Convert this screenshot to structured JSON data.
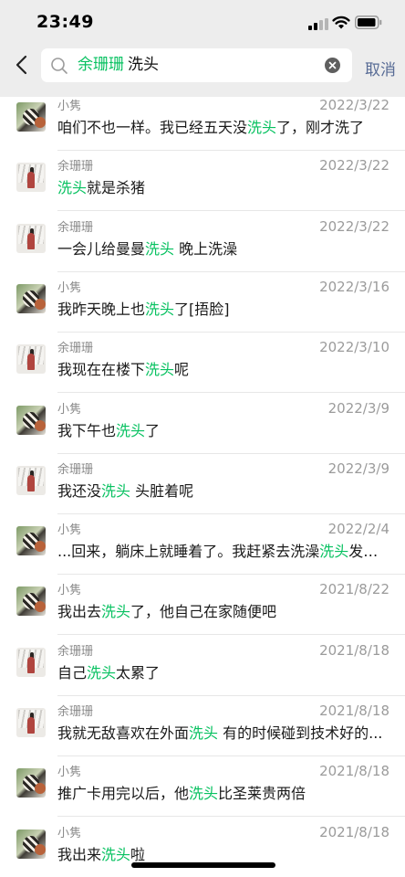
{
  "status_bar": {
    "time": "23:49"
  },
  "search": {
    "contact": "余珊珊",
    "keyword": "洗头",
    "cancel_label": "取消"
  },
  "results": [
    {
      "sender": "小隽",
      "avatar": "a",
      "date": "2022/3/22",
      "before": "咱们不也一样。我已经五天没",
      "match": "洗头",
      "after": "了，刚才洗了"
    },
    {
      "sender": "余珊珊",
      "avatar": "b",
      "date": "2022/3/22",
      "before": "",
      "match": "洗头",
      "after": "就是杀猪"
    },
    {
      "sender": "余珊珊",
      "avatar": "b",
      "date": "2022/3/22",
      "before": "一会儿给曼曼",
      "match": "洗头",
      "after": " 晚上洗澡"
    },
    {
      "sender": "小隽",
      "avatar": "a",
      "date": "2022/3/16",
      "before": "我昨天晚上也",
      "match": "洗头",
      "after": "了[捂脸]"
    },
    {
      "sender": "余珊珊",
      "avatar": "b",
      "date": "2022/3/10",
      "before": "我现在在楼下",
      "match": "洗头",
      "after": "呢"
    },
    {
      "sender": "小隽",
      "avatar": "a",
      "date": "2022/3/9",
      "before": "我下午也",
      "match": "洗头",
      "after": "了"
    },
    {
      "sender": "余珊珊",
      "avatar": "b",
      "date": "2022/3/9",
      "before": "我还没",
      "match": "洗头",
      "after": " 头脏着呢"
    },
    {
      "sender": "小隽",
      "avatar": "a",
      "date": "2022/2/4",
      "before": "...回来，躺床上就睡着了。我赶紧去洗澡",
      "match": "洗头",
      "after": "发，..."
    },
    {
      "sender": "小隽",
      "avatar": "a",
      "date": "2021/8/22",
      "before": "我出去",
      "match": "洗头",
      "after": "了，他自己在家随便吧"
    },
    {
      "sender": "余珊珊",
      "avatar": "b",
      "date": "2021/8/18",
      "before": "自己",
      "match": "洗头",
      "after": "太累了"
    },
    {
      "sender": "余珊珊",
      "avatar": "b",
      "date": "2021/8/18",
      "before": "我就无敌喜欢在外面",
      "match": "洗头",
      "after": " 有的时候碰到技术好的..."
    },
    {
      "sender": "小隽",
      "avatar": "a",
      "date": "2021/8/18",
      "before": "推广卡用完以后，他",
      "match": "洗头",
      "after": "比圣莱贵两倍"
    },
    {
      "sender": "小隽",
      "avatar": "a",
      "date": "2021/8/18",
      "before": "我出来",
      "match": "洗头",
      "after": "啦"
    }
  ]
}
